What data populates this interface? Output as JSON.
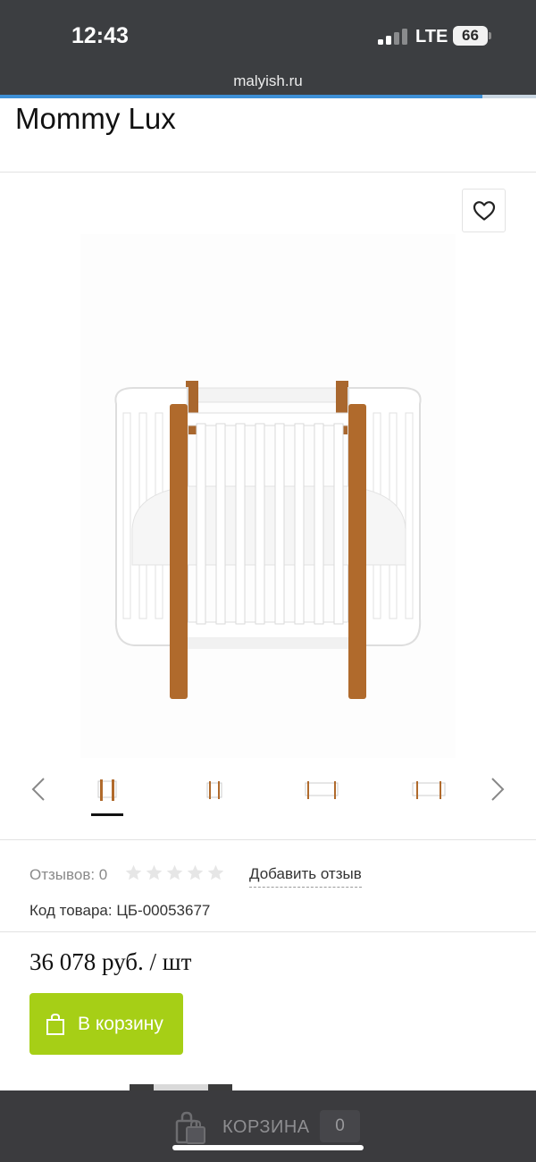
{
  "status_bar": {
    "time": "12:43",
    "network": "LTE",
    "battery": "66"
  },
  "browser": {
    "url": "malyish.ru",
    "load_progress": 0.9
  },
  "product": {
    "title": "Mommy Lux",
    "reviews_label": "Отзывов: 0",
    "rating_stars": 0,
    "rating_max": 5,
    "add_review": "Добавить отзыв",
    "sku_label": "Код товара: ЦБ-00053677",
    "price": "36 078 руб. / шт",
    "add_to_cart": "В корзину"
  },
  "gallery": {
    "thumbnail_count": 4,
    "selected_index": 0
  },
  "bottom_bar": {
    "cart_label": "КОРЗИНА",
    "cart_count": "0"
  },
  "colors": {
    "accent_green": "#a6cf16",
    "dark_bar": "#3b3b3e",
    "wood": "#b06a2c"
  },
  "icons": [
    "signal-icon",
    "battery-icon",
    "heart-icon",
    "chevron-left-icon",
    "chevron-right-icon",
    "star-icon",
    "shopping-bag-icon"
  ]
}
